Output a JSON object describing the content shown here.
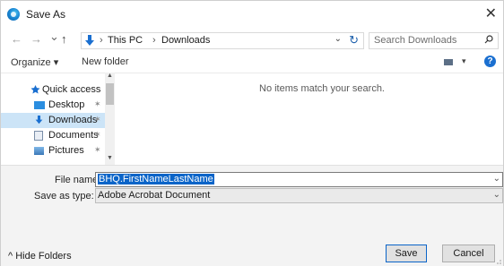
{
  "window": {
    "title": "Save As",
    "close_glyph": "✕"
  },
  "nav": {
    "back_glyph": "←",
    "forward_glyph": "→",
    "recent_glyph": "⌄",
    "up_glyph": "↑",
    "breadcrumbs": [
      "This PC",
      "Downloads"
    ],
    "search_placeholder": "Search Downloads"
  },
  "toolbar": {
    "organize_label": "Organize ▾",
    "new_folder_label": "New folder"
  },
  "nav_pane": {
    "items": [
      {
        "label": "Quick access",
        "icon": "star-icon"
      },
      {
        "label": "Desktop",
        "icon": "desktop-icon",
        "pinned": true
      },
      {
        "label": "Downloads",
        "icon": "download-icon",
        "pinned": true,
        "selected": true
      },
      {
        "label": "Documents",
        "icon": "documents-icon",
        "pinned": true
      },
      {
        "label": "Pictures",
        "icon": "pictures-icon",
        "pinned": true
      }
    ]
  },
  "content": {
    "empty_message": "No items match your search."
  },
  "form": {
    "file_name_label": "File name:",
    "file_name_value": "BHQ.FirstNameLastName",
    "save_type_label": "Save as type:",
    "save_type_value": "Adobe Acrobat Document"
  },
  "footer": {
    "hide_folders_label": "Hide Folders",
    "save_label": "Save",
    "cancel_label": "Cancel"
  },
  "colors": {
    "accent": "#0a64c8",
    "selection": "#cce4f7",
    "panel": "#f3f3f3"
  }
}
